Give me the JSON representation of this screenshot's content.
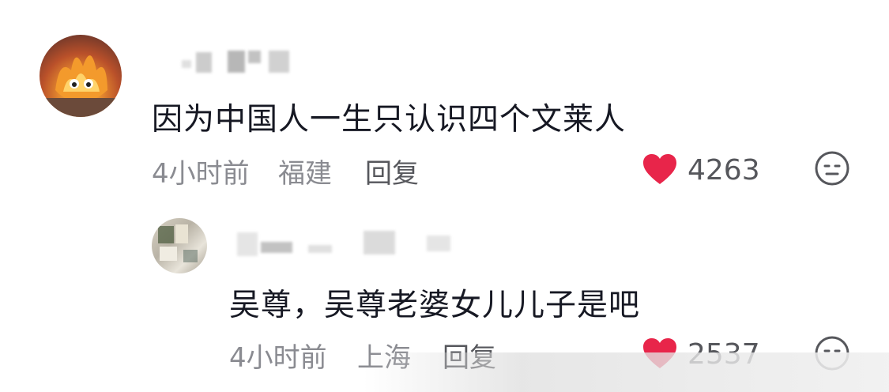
{
  "comments": [
    {
      "text": "因为中国人一生只认识四个文莱人",
      "time": "4小时前",
      "location": "福建",
      "reply_label": "回复",
      "likes": "4263"
    },
    {
      "text": "吴尊，吴尊老婆女儿儿子是吧",
      "time": "4小时前",
      "location": "上海",
      "reply_label": "回复",
      "likes": "2537"
    }
  ],
  "colors": {
    "heart": "#e8254a",
    "meta_text": "#8a8b91",
    "main_text": "#161823"
  },
  "icons": [
    "avatar",
    "heart-icon",
    "emoji-reaction-icon"
  ]
}
